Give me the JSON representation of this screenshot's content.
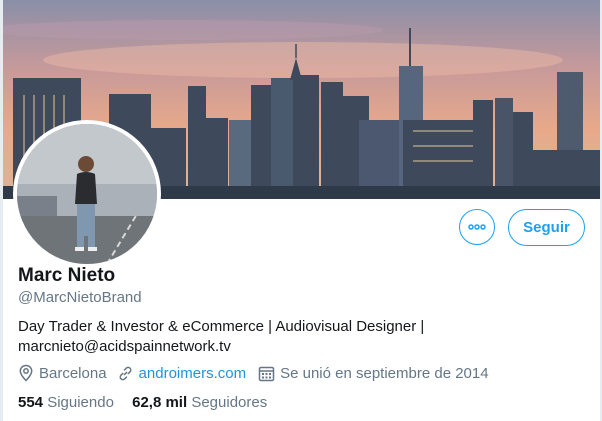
{
  "profile": {
    "name": "Marc Nieto",
    "handle": "@MarcNietoBrand",
    "bio_line1": "Day Trader & Investor & eCommerce | Audiovisual Designer |",
    "bio_line2": "marcnieto@acidspainnetwork.tv",
    "location": "Barcelona",
    "website": "androimers.com",
    "joined": "Se unió en septiembre de 2014"
  },
  "stats": {
    "following_count": "554",
    "following_label": "Siguiendo",
    "followers_count": "62,8 mil",
    "followers_label": "Seguidores"
  },
  "actions": {
    "follow_label": "Seguir"
  },
  "icons": {
    "more": "more-options-icon",
    "location": "location-pin-icon",
    "link": "link-icon",
    "calendar": "calendar-icon"
  },
  "colors": {
    "accent": "#1da1f2",
    "link": "#1b95e0",
    "secondary_text": "#657786",
    "primary_text": "#14171a"
  }
}
